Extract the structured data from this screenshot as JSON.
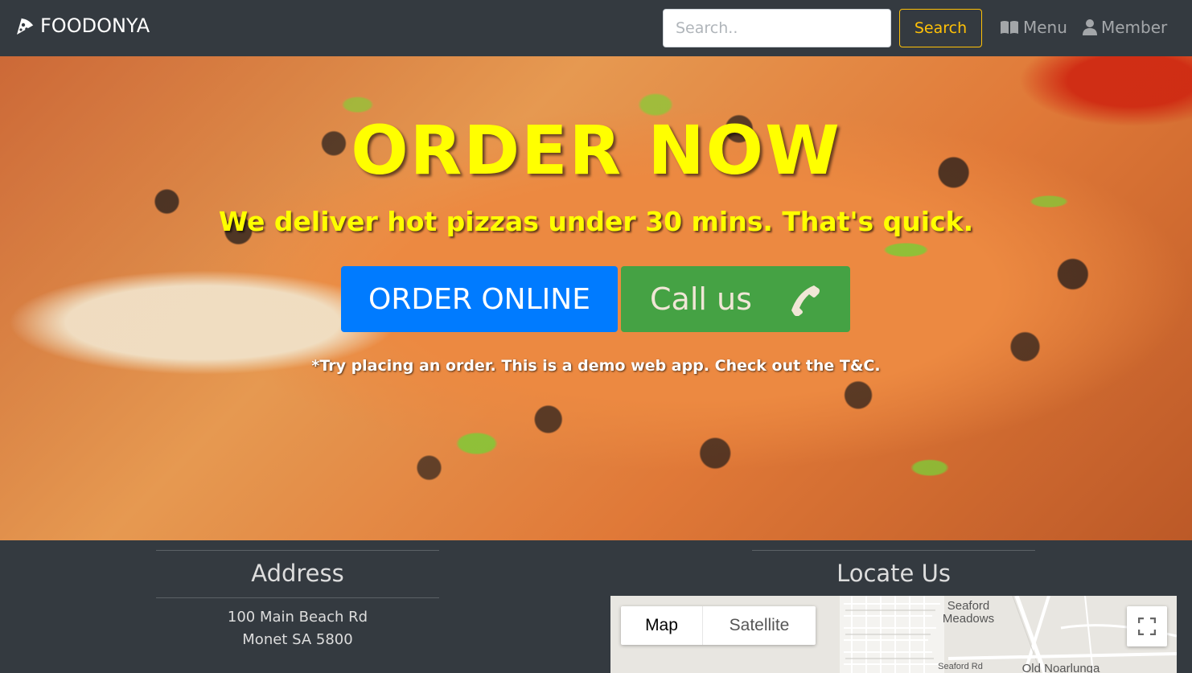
{
  "navbar": {
    "brand": "FOODONYA",
    "search_placeholder": "Search..",
    "search_button": "Search",
    "links": [
      {
        "label": "Menu",
        "icon": "book-open-icon"
      },
      {
        "label": "Member",
        "icon": "user-icon"
      }
    ],
    "accent_color": "#ffc107"
  },
  "hero": {
    "title": "ORDER NOW",
    "subtitle": "We deliver hot pizzas under 30 mins. That's quick.",
    "order_button": "ORDER ONLINE",
    "call_button": "Call us",
    "note": "*Try placing an order. This is a demo web app. Check out the T&C.",
    "title_color": "#ffff00",
    "order_color": "#007bff",
    "call_color": "#28a745"
  },
  "footer": {
    "address_heading": "Address",
    "address_lines": [
      "100 Main Beach Rd",
      "Monet SA 5800"
    ],
    "locate_heading": "Locate Us",
    "map": {
      "type_map": "Map",
      "type_satellite": "Satellite",
      "labels": {
        "suburb": "Seaford Meadows",
        "road": "Seaford Rd",
        "town": "Old Noarlunga"
      }
    }
  }
}
